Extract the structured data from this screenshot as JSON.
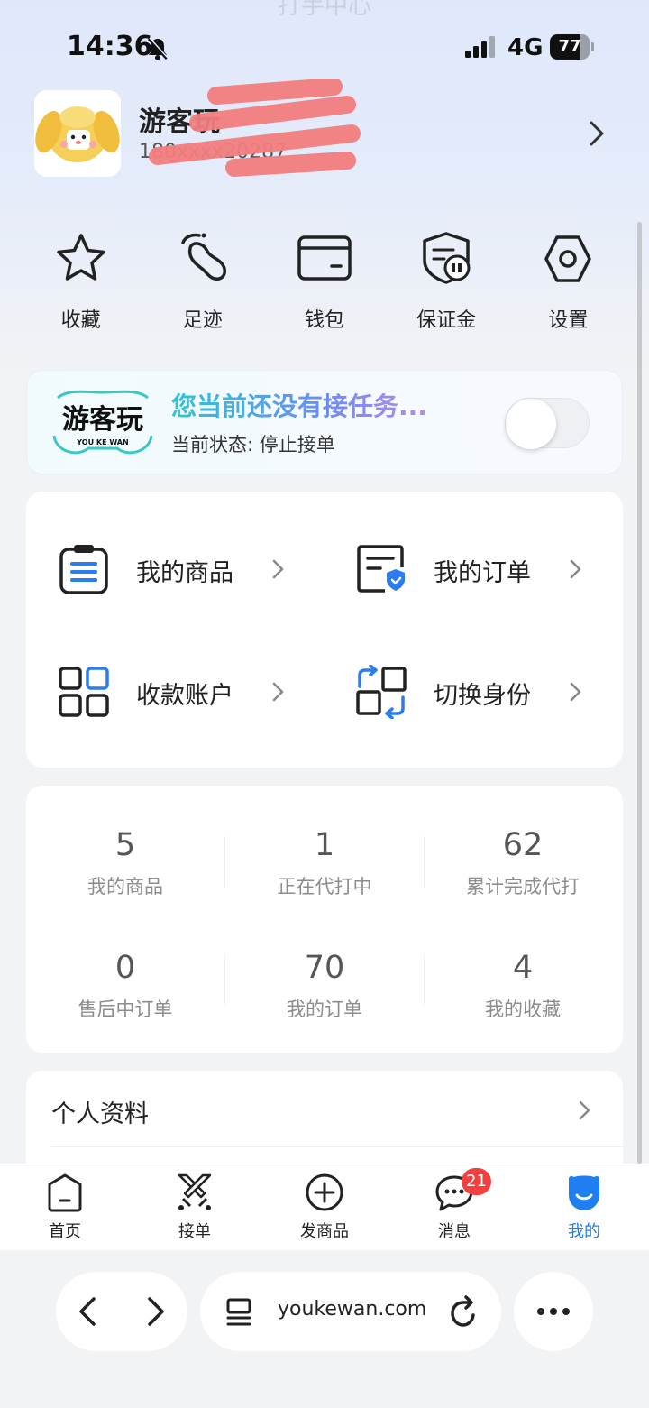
{
  "status": {
    "time": "14:36",
    "network": "4G",
    "battery": "77",
    "battery_level": 0.77
  },
  "header": {
    "ghost_title": "打手中心"
  },
  "profile": {
    "name": "游客玩",
    "phone": "180",
    "phone_tail": "20287"
  },
  "quick_actions": [
    {
      "label": "收藏",
      "icon": "star-icon"
    },
    {
      "label": "足迹",
      "icon": "footprint-icon"
    },
    {
      "label": "钱包",
      "icon": "wallet-icon"
    },
    {
      "label": "保证金",
      "icon": "deposit-icon"
    },
    {
      "label": "设置",
      "icon": "settings-icon"
    }
  ],
  "task_card": {
    "logo_text": "游客玩",
    "logo_sub": "YOU KE WAN",
    "title": "您当前还没有接任务...",
    "status": "当前状态: 停止接单",
    "toggle_on": false
  },
  "menu": [
    {
      "label": "我的商品",
      "icon": "clipboard-list-icon"
    },
    {
      "label": "我的订单",
      "icon": "order-shield-icon"
    },
    {
      "label": "收款账户",
      "icon": "grid-account-icon"
    },
    {
      "label": "切换身份",
      "icon": "switch-identity-icon"
    }
  ],
  "stats": [
    {
      "value": "5",
      "label": "我的商品"
    },
    {
      "value": "1",
      "label": "正在代打中"
    },
    {
      "value": "62",
      "label": "累计完成代打"
    },
    {
      "value": "0",
      "label": "售后中订单"
    },
    {
      "value": "70",
      "label": "我的订单"
    },
    {
      "value": "4",
      "label": "我的收藏"
    }
  ],
  "info": {
    "label": "个人资料"
  },
  "tabs": [
    {
      "label": "首页",
      "icon": "home-icon"
    },
    {
      "label": "接单",
      "icon": "crossed-swords-icon"
    },
    {
      "label": "发商品",
      "icon": "plus-circle-icon"
    },
    {
      "label": "消息",
      "icon": "chat-icon",
      "badge": "21"
    },
    {
      "label": "我的",
      "icon": "profile-face-icon",
      "active": true
    }
  ],
  "browser": {
    "url": "youkewan.com"
  },
  "colors": {
    "accent": "#1f7ef0",
    "badge": "#f43f3f",
    "icon_blue": "#2b7cf0"
  }
}
